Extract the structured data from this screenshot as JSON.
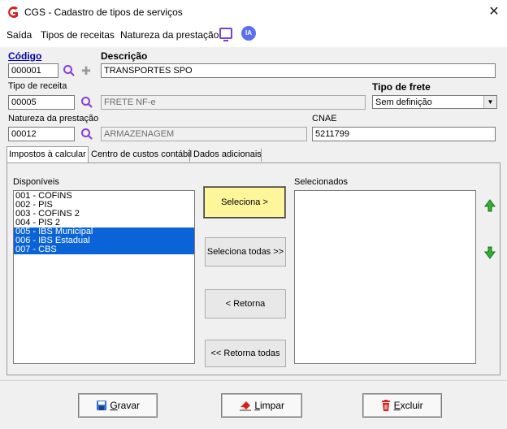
{
  "window": {
    "title": "CGS - Cadastro de tipos de serviços",
    "close_glyph": "✕"
  },
  "menu": {
    "items": [
      "Saída",
      "Tipos de receitas",
      "Natureza da prestação"
    ],
    "ia_label": "IA"
  },
  "form": {
    "codigo": {
      "label": "Código",
      "value": "000001"
    },
    "descricao": {
      "label": "Descrição",
      "value": "TRANSPORTES SPO"
    },
    "tipo_receita": {
      "label": "Tipo de receita",
      "code": "00005",
      "description": "FRETE NF-e"
    },
    "tipo_frete": {
      "label": "Tipo de frete",
      "selected": "Sem definição"
    },
    "natureza": {
      "label": "Natureza da prestação",
      "code": "00012",
      "description": "ARMAZENAGEM"
    },
    "cnae": {
      "label": "CNAE",
      "value": "5211799"
    }
  },
  "tabs": [
    "Impostos à calcular",
    "Centro de custos contábil",
    "Dados adicionais"
  ],
  "panel": {
    "available_label": "Disponíveis",
    "selected_label": "Selecionados",
    "available_items": [
      {
        "text": "001 - COFINS",
        "selected": false
      },
      {
        "text": "002 - PIS",
        "selected": false
      },
      {
        "text": "003 - COFINS 2",
        "selected": false
      },
      {
        "text": "004 - PIS 2",
        "selected": false
      },
      {
        "text": "005 - IBS Municipal",
        "selected": true
      },
      {
        "text": "006 - IBS Estadual",
        "selected": true
      },
      {
        "text": "007 - CBS",
        "selected": true
      }
    ],
    "buttons": {
      "seleciona": "Seleciona >",
      "seleciona_todas": "Seleciona todas >>",
      "retorna": "< Retorna",
      "retorna_todas": "<< Retorna todas"
    }
  },
  "bottom": {
    "gravar": {
      "mnemonic": "G",
      "rest": "ravar"
    },
    "limpar": {
      "mnemonic": "L",
      "rest": "impar"
    },
    "excluir": {
      "mnemonic": "E",
      "rest": "xcluir"
    }
  },
  "colors": {
    "accent_red": "#d42020",
    "selection_blue": "#0a64d8",
    "focus_yellow": "#fff59a",
    "arrow_green": "#1a9c1a",
    "icon_purple": "#7a3de0"
  }
}
